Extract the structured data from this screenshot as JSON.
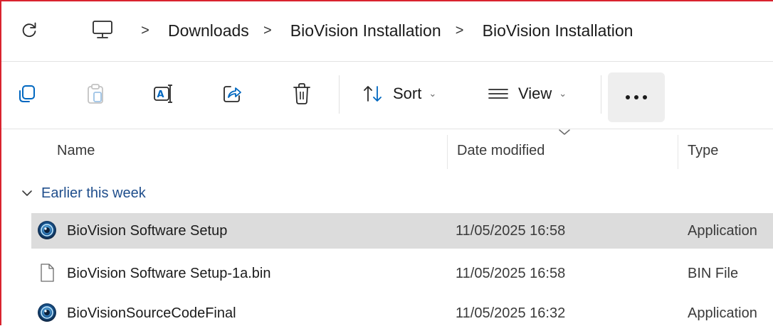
{
  "address": {
    "crumbs": [
      "Downloads",
      "BioVision Installation",
      "BioVision Installation"
    ],
    "separator": ">",
    "icons": {
      "refresh": "refresh-icon",
      "root": "this-pc-icon"
    }
  },
  "toolbar": {
    "icons": [
      "new-icon",
      "paste-icon",
      "rename-icon",
      "share-icon",
      "delete-icon"
    ],
    "sort_label": "Sort",
    "view_label": "View",
    "dropdown_glyph": "⌄"
  },
  "columns": {
    "name": "Name",
    "date": "Date modified",
    "type": "Type",
    "sorted_column": "Date modified"
  },
  "group": {
    "label": "Earlier this week"
  },
  "files": [
    {
      "name": "BioVision Software Setup",
      "date": "11/05/2025 16:58",
      "type": "Application",
      "icon": "app-icon",
      "selected": true
    },
    {
      "name": "BioVision Software Setup-1a.bin",
      "date": "11/05/2025 16:58",
      "type": "BIN File",
      "icon": "file-icon",
      "selected": false
    },
    {
      "name": "BioVisionSourceCodeFinal",
      "date": "11/05/2025 16:32",
      "type": "Application",
      "icon": "app-icon",
      "selected": false
    }
  ],
  "colors": {
    "frame_accent": "#d9232e",
    "accent_blue": "#0067c0",
    "group_text": "#1f4e8c",
    "selected_row": "#dcdcdc"
  }
}
